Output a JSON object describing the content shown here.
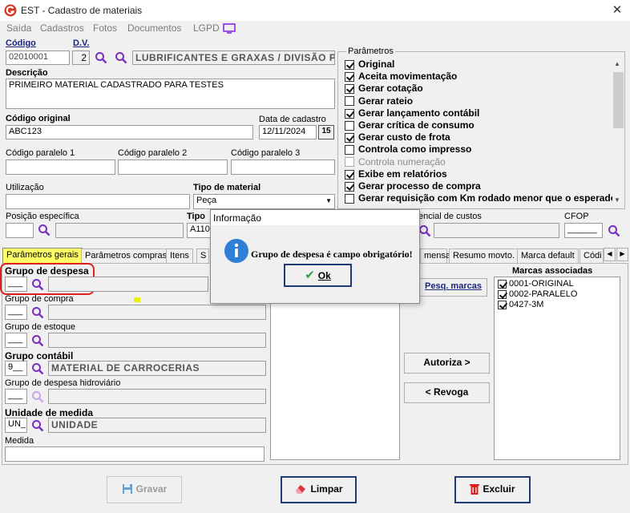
{
  "window": {
    "title": "EST - Cadastro de materiais"
  },
  "menu": [
    "Saída",
    "Cadastros",
    "Fotos",
    "Documentos",
    "LGPD"
  ],
  "header": {
    "codigo_label": "Código",
    "codigo_value": "02010001",
    "dv_label": "D.V.",
    "dv_value": "2",
    "group_value": "LUBRIFICANTES E GRAXAS / DIVISÃO PAI",
    "descricao_label": "Descrição",
    "descricao_value": "PRIMEIRO MATERIAL CADASTRADO PARA TESTES",
    "codigo_original_label": "Código original",
    "codigo_original_value": "ABC123",
    "data_cadastro_label": "Data de cadastro",
    "data_cadastro_value": "12/11/2024",
    "calendar_value": "15",
    "codigo_paralelo1_label": "Código paralelo 1",
    "codigo_paralelo2_label": "Código paralelo 2",
    "codigo_paralelo3_label": "Código paralelo 3",
    "utilizacao_label": "Utilização",
    "tipo_material_label": "Tipo de material",
    "tipo_material_value": "Peça",
    "posicao_label": "Posição específica",
    "tipo_label": "Tipo",
    "tipo_value": "A110",
    "centro_custos_label": "encial de custos",
    "cfop_label": "CFOP",
    "cfop_value": "______"
  },
  "parametros": {
    "title": "Parâmetros",
    "items": [
      {
        "label": "Original",
        "checked": true,
        "disabled": false
      },
      {
        "label": "Aceita movimentação",
        "checked": true,
        "disabled": false
      },
      {
        "label": "Gerar cotação",
        "checked": true,
        "disabled": false
      },
      {
        "label": "Gerar rateio",
        "checked": false,
        "disabled": false
      },
      {
        "label": "Gerar lançamento contábil",
        "checked": true,
        "disabled": false
      },
      {
        "label": "Gerar crítica de consumo",
        "checked": false,
        "disabled": false
      },
      {
        "label": "Gerar custo de frota",
        "checked": true,
        "disabled": false
      },
      {
        "label": "Controla como impresso",
        "checked": false,
        "disabled": false
      },
      {
        "label": "Controla numeração",
        "checked": false,
        "disabled": true
      },
      {
        "label": "Exibe em relatórios",
        "checked": true,
        "disabled": false
      },
      {
        "label": "Gerar processo de compra",
        "checked": true,
        "disabled": false
      },
      {
        "label": "Gerar requisição com Km rodado menor que o esperado",
        "checked": false,
        "disabled": false
      }
    ]
  },
  "tabs": [
    {
      "label": "Parâmetros gerais",
      "active": true
    },
    {
      "label": "Parâmetros compras",
      "active": false
    },
    {
      "label": "Itens",
      "active": false
    },
    {
      "label": "S",
      "active": false
    },
    {
      "label": "mensal",
      "active": false
    },
    {
      "label": "Resumo movto.",
      "active": false
    },
    {
      "label": "Marca default",
      "active": false
    },
    {
      "label": "Códi",
      "active": false
    }
  ],
  "tab_content": {
    "grupo_despesa_label": "Grupo de despesa",
    "grupo_despesa_value": "___",
    "grupo_compra_label": "Grupo de compra",
    "grupo_compra_value": "___",
    "grupo_estoque_label": "Grupo de estoque",
    "grupo_estoque_value": "___",
    "grupo_contabil_label": "Grupo contábil",
    "grupo_contabil_value": "9__",
    "grupo_contabil_desc": "MATERIAL DE CARROCERIAS",
    "grupo_hidro_label": "Grupo de despesa hidroviário",
    "grupo_hidro_value": "___",
    "unidade_label": "Unidade de medida",
    "unidade_value": "UN_",
    "unidade_desc": "UNIDADE",
    "medida_label": "Medida"
  },
  "marcas": {
    "pesq_button": "Pesq. marcas",
    "title": "Marcas associadas",
    "items": [
      {
        "label": "0001-ORIGINAL",
        "checked": true
      },
      {
        "label": "0002-PARALELO",
        "checked": true
      },
      {
        "label": "0427-3M",
        "checked": true
      }
    ],
    "autoriza_button": "Autoriza >",
    "revoga_button": "< Revoga"
  },
  "footer": {
    "gravar_button": "Gravar",
    "limpar_button": "Limpar",
    "excluir_button": "Excluir"
  },
  "dialog": {
    "title": "Informação",
    "message": "Grupo de despesa é campo obrigatório!",
    "ok_button": "Ok"
  },
  "colors": {
    "app_icon": "#d23a2a",
    "magnifier": "#7b2fbf",
    "active_tab": "#ffff66",
    "highlight_ring": "#e02020",
    "info_icon": "#2f7fd8",
    "ok_check": "#2aa33a"
  }
}
